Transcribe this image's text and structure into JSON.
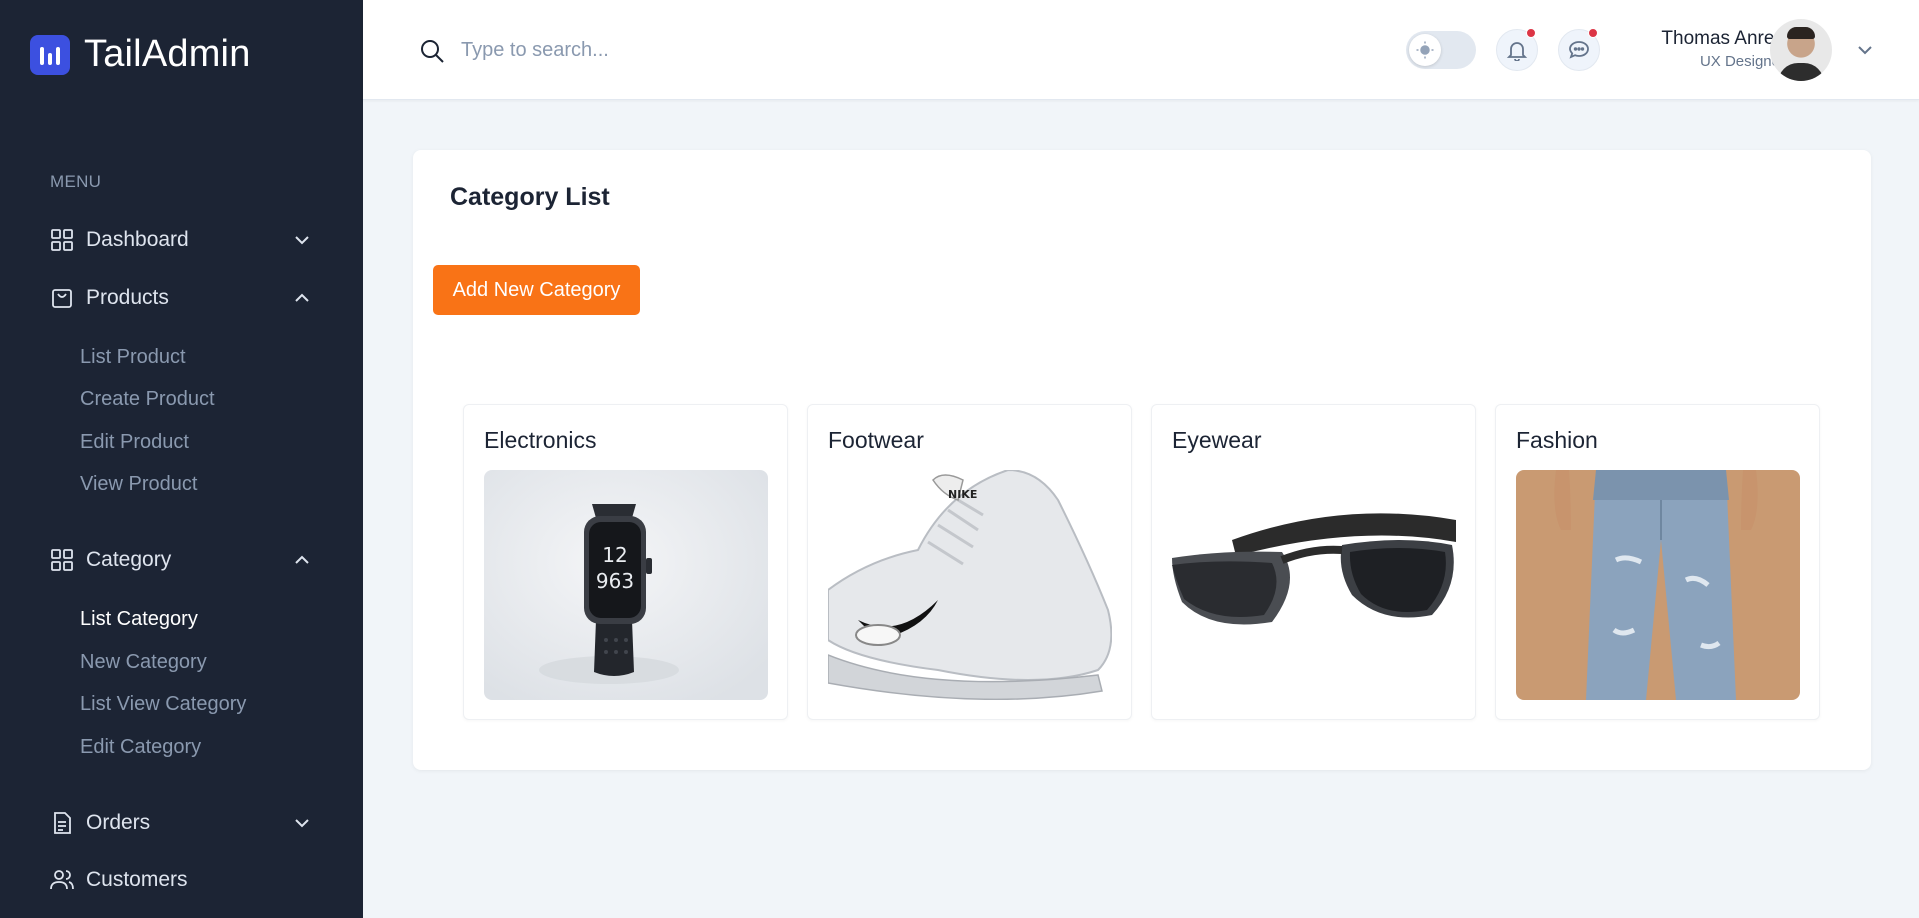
{
  "brand": {
    "name": "TailAdmin",
    "accent": "#3c50e0"
  },
  "sidebar": {
    "menu_label": "MENU",
    "items": [
      {
        "label": "Dashboard",
        "icon": "grid-icon",
        "expanded": false
      },
      {
        "label": "Products",
        "icon": "bag-icon",
        "expanded": true,
        "children": [
          "List Product",
          "Create Product",
          "Edit Product",
          "View Product"
        ]
      },
      {
        "label": "Category",
        "icon": "grid-icon",
        "expanded": true,
        "children": [
          "List Category",
          "New Category",
          "List View Category",
          "Edit Category"
        ],
        "active_child": "List Category"
      },
      {
        "label": "Orders",
        "icon": "document-icon",
        "expanded": false
      },
      {
        "label": "Customers",
        "icon": "users-icon"
      }
    ]
  },
  "header": {
    "search_placeholder": "Type to search...",
    "user_name": "Thomas Anree",
    "user_role": "UX Designer",
    "notification_dot_color": "#dc3545"
  },
  "main": {
    "title": "Category List",
    "add_button": "Add New Category",
    "add_button_color": "#f97316",
    "categories": [
      {
        "name": "Electronics",
        "image": "smartwatch"
      },
      {
        "name": "Footwear",
        "image": "white sneaker"
      },
      {
        "name": "Eyewear",
        "image": "sunglasses"
      },
      {
        "name": "Fashion",
        "image": "jeans"
      }
    ]
  }
}
